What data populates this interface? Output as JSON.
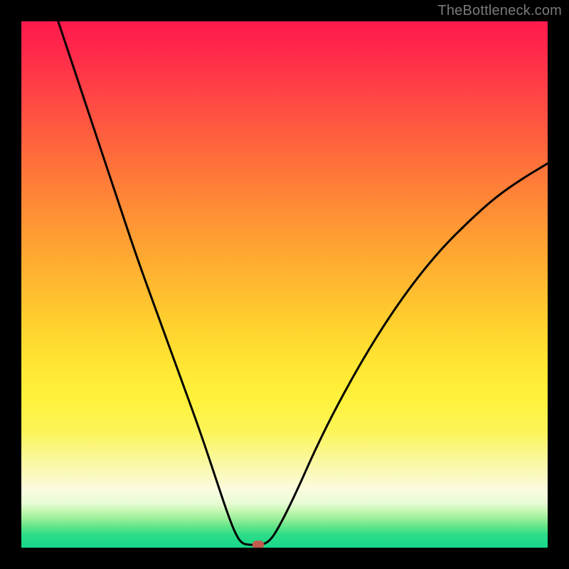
{
  "watermark": "TheBottleneck.com",
  "chart_data": {
    "type": "line",
    "title": "",
    "xlabel": "",
    "ylabel": "",
    "xlim": [
      0,
      100
    ],
    "ylim": [
      0,
      100
    ],
    "grid": false,
    "legend": false,
    "curve": [
      {
        "x": 7,
        "y": 100
      },
      {
        "x": 10,
        "y": 91
      },
      {
        "x": 14,
        "y": 79
      },
      {
        "x": 18,
        "y": 67
      },
      {
        "x": 22,
        "y": 55
      },
      {
        "x": 26,
        "y": 44
      },
      {
        "x": 30,
        "y": 33
      },
      {
        "x": 34,
        "y": 22
      },
      {
        "x": 37,
        "y": 13
      },
      {
        "x": 39,
        "y": 7
      },
      {
        "x": 40.5,
        "y": 3
      },
      {
        "x": 41.8,
        "y": 0.8
      },
      {
        "x": 43.5,
        "y": 0.5
      },
      {
        "x": 45.5,
        "y": 0.5
      },
      {
        "x": 47.2,
        "y": 1.2
      },
      {
        "x": 49,
        "y": 4
      },
      {
        "x": 52,
        "y": 10
      },
      {
        "x": 56,
        "y": 19
      },
      {
        "x": 60,
        "y": 27
      },
      {
        "x": 65,
        "y": 36
      },
      {
        "x": 70,
        "y": 44
      },
      {
        "x": 75,
        "y": 51
      },
      {
        "x": 80,
        "y": 57
      },
      {
        "x": 85,
        "y": 62
      },
      {
        "x": 90,
        "y": 66.5
      },
      {
        "x": 95,
        "y": 70
      },
      {
        "x": 100,
        "y": 73
      }
    ],
    "marker": {
      "x": 45,
      "y": 0.5,
      "color": "#c35a4e"
    },
    "colors": {
      "top": "#ff1a4d",
      "mid": "#ffd22e",
      "bottom": "#16d88a",
      "curve": "#000000"
    }
  }
}
